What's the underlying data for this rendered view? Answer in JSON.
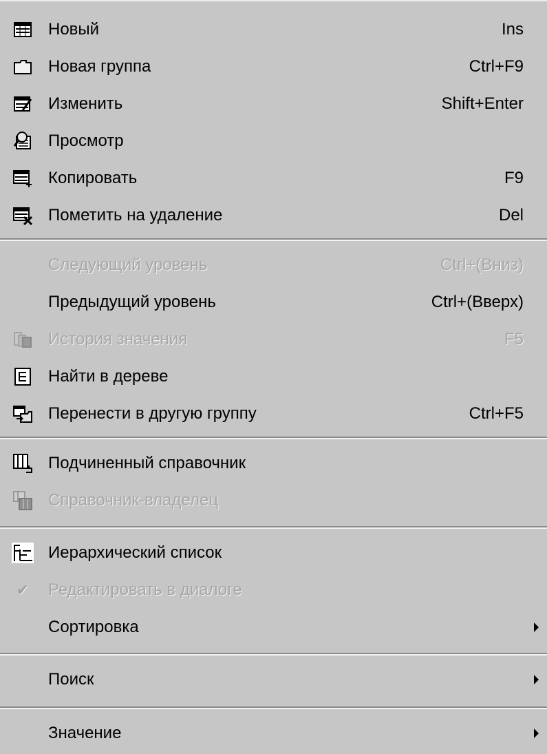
{
  "menu": {
    "items": [
      {
        "label": "Новый",
        "shortcut": "Ins",
        "icon": "new-record-icon",
        "disabled": false
      },
      {
        "label": "Новая группа",
        "shortcut": "Ctrl+F9",
        "icon": "folder-icon",
        "disabled": false
      },
      {
        "label": "Изменить",
        "shortcut": "Shift+Enter",
        "icon": "edit-record-icon",
        "disabled": false
      },
      {
        "label": "Просмотр",
        "shortcut": "",
        "icon": "view-magnifier-icon",
        "disabled": false
      },
      {
        "label": "Копировать",
        "shortcut": "F9",
        "icon": "copy-record-icon",
        "disabled": false
      },
      {
        "label": "Пометить на удаление",
        "shortcut": "Del",
        "icon": "mark-delete-icon",
        "disabled": false
      },
      {
        "label": "Следующий уровень",
        "shortcut": "Ctrl+(Вниз)",
        "icon": "",
        "disabled": true
      },
      {
        "label": "Предыдущий уровень",
        "shortcut": "Ctrl+(Вверх)",
        "icon": "",
        "disabled": false
      },
      {
        "label": "История значения",
        "shortcut": "F5",
        "icon": "history-icon",
        "disabled": true
      },
      {
        "label": "Найти в дереве",
        "shortcut": "",
        "icon": "tree-find-icon",
        "disabled": false
      },
      {
        "label": "Перенести в другую группу",
        "shortcut": "Ctrl+F5",
        "icon": "move-group-icon",
        "disabled": false
      },
      {
        "label": "Подчиненный справочник",
        "shortcut": "",
        "icon": "sub-catalog-icon",
        "disabled": false
      },
      {
        "label": "Справочник-владелец",
        "shortcut": "",
        "icon": "owner-catalog-icon",
        "disabled": true
      },
      {
        "label": "Иерархический список",
        "shortcut": "",
        "icon": "hierarchy-list-icon",
        "disabled": false
      },
      {
        "label": "Редактировать в диалоге",
        "shortcut": "",
        "icon": "checkmark-icon",
        "disabled": true
      },
      {
        "label": "Сортировка",
        "shortcut": "",
        "icon": "",
        "disabled": false,
        "submenu": true
      },
      {
        "label": "Поиск",
        "shortcut": "",
        "icon": "",
        "disabled": false,
        "submenu": true
      },
      {
        "label": "Значение",
        "shortcut": "",
        "icon": "",
        "disabled": false,
        "submenu": true
      }
    ]
  }
}
